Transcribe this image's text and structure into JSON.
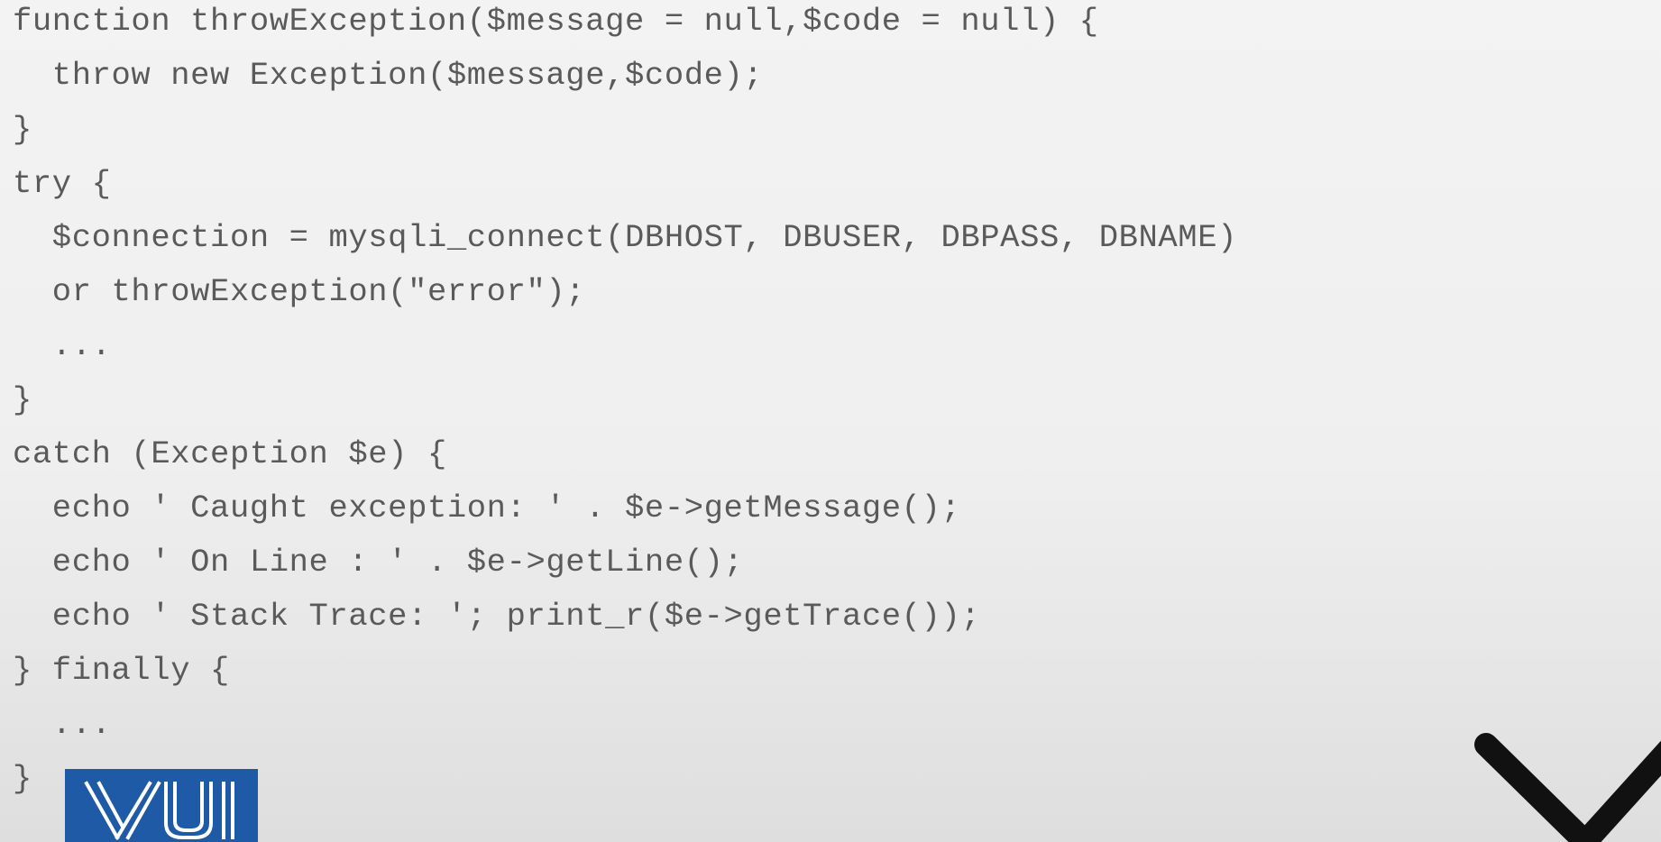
{
  "code": {
    "lines": [
      "function throwException($message = null,$code = null) {",
      "  throw new Exception($message,$code);",
      "}",
      "try {",
      "  $connection = mysqli_connect(DBHOST, DBUSER, DBPASS, DBNAME)",
      "  or throwException(\"error\");",
      "  ...",
      "}",
      "catch (Exception $e) {",
      "  echo ' Caught exception: ' . $e->getMessage();",
      "  echo ' On Line : ' . $e->getLine();",
      "  echo ' Stack Trace: '; print_r($e->getTrace());",
      "} finally {",
      "  ...",
      "}"
    ]
  },
  "logo": {
    "text": "VU",
    "color": "#1f5aa6"
  },
  "icons": {
    "next": "chevron-down-icon"
  },
  "colors": {
    "code_text": "#5a5a5a",
    "background": "#efefef"
  }
}
